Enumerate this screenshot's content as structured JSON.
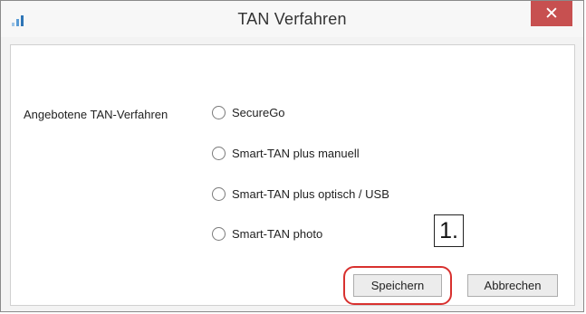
{
  "window": {
    "title": "TAN Verfahren",
    "close_label": "✕",
    "accent_color": "#c75050"
  },
  "icons": {
    "app": "signal-bars-icon",
    "close": "close-icon"
  },
  "form": {
    "group_label": "Angebotene TAN-Verfahren",
    "options": [
      {
        "label": "SecureGo",
        "selected": false
      },
      {
        "label": "Smart-TAN plus manuell",
        "selected": false
      },
      {
        "label": "Smart-TAN plus optisch / USB",
        "selected": false
      },
      {
        "label": "Smart-TAN photo",
        "selected": false
      }
    ]
  },
  "annotation": {
    "step_label": "1.",
    "highlight_color": "#d8312f"
  },
  "buttons": {
    "save_label": "Speichern",
    "cancel_label": "Abbrechen"
  }
}
